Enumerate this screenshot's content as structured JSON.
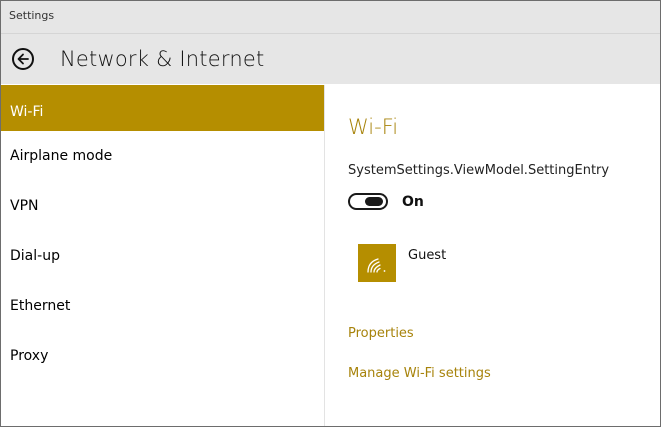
{
  "window": {
    "title": "Settings"
  },
  "header": {
    "title": "Network & Internet",
    "back_icon": "back-arrow-icon"
  },
  "sidebar": {
    "items": [
      {
        "label": "Wi-Fi",
        "selected": true
      },
      {
        "label": "Airplane mode",
        "selected": false
      },
      {
        "label": "VPN",
        "selected": false
      },
      {
        "label": "Dial-up",
        "selected": false
      },
      {
        "label": "Ethernet",
        "selected": false
      },
      {
        "label": "Proxy",
        "selected": false
      }
    ]
  },
  "main": {
    "section_title": "Wi-Fi",
    "setting_label": "SystemSettings.ViewModel.SettingEntry",
    "toggle": {
      "state": "On",
      "on": true
    },
    "network": {
      "name": "Guest",
      "icon": "wifi-signal-icon"
    },
    "links": {
      "properties": "Properties",
      "manage": "Manage Wi-Fi settings"
    }
  },
  "colors": {
    "accent": "#b58e00",
    "accent_text": "#a7830b",
    "header_bg": "#e6e6e6"
  }
}
